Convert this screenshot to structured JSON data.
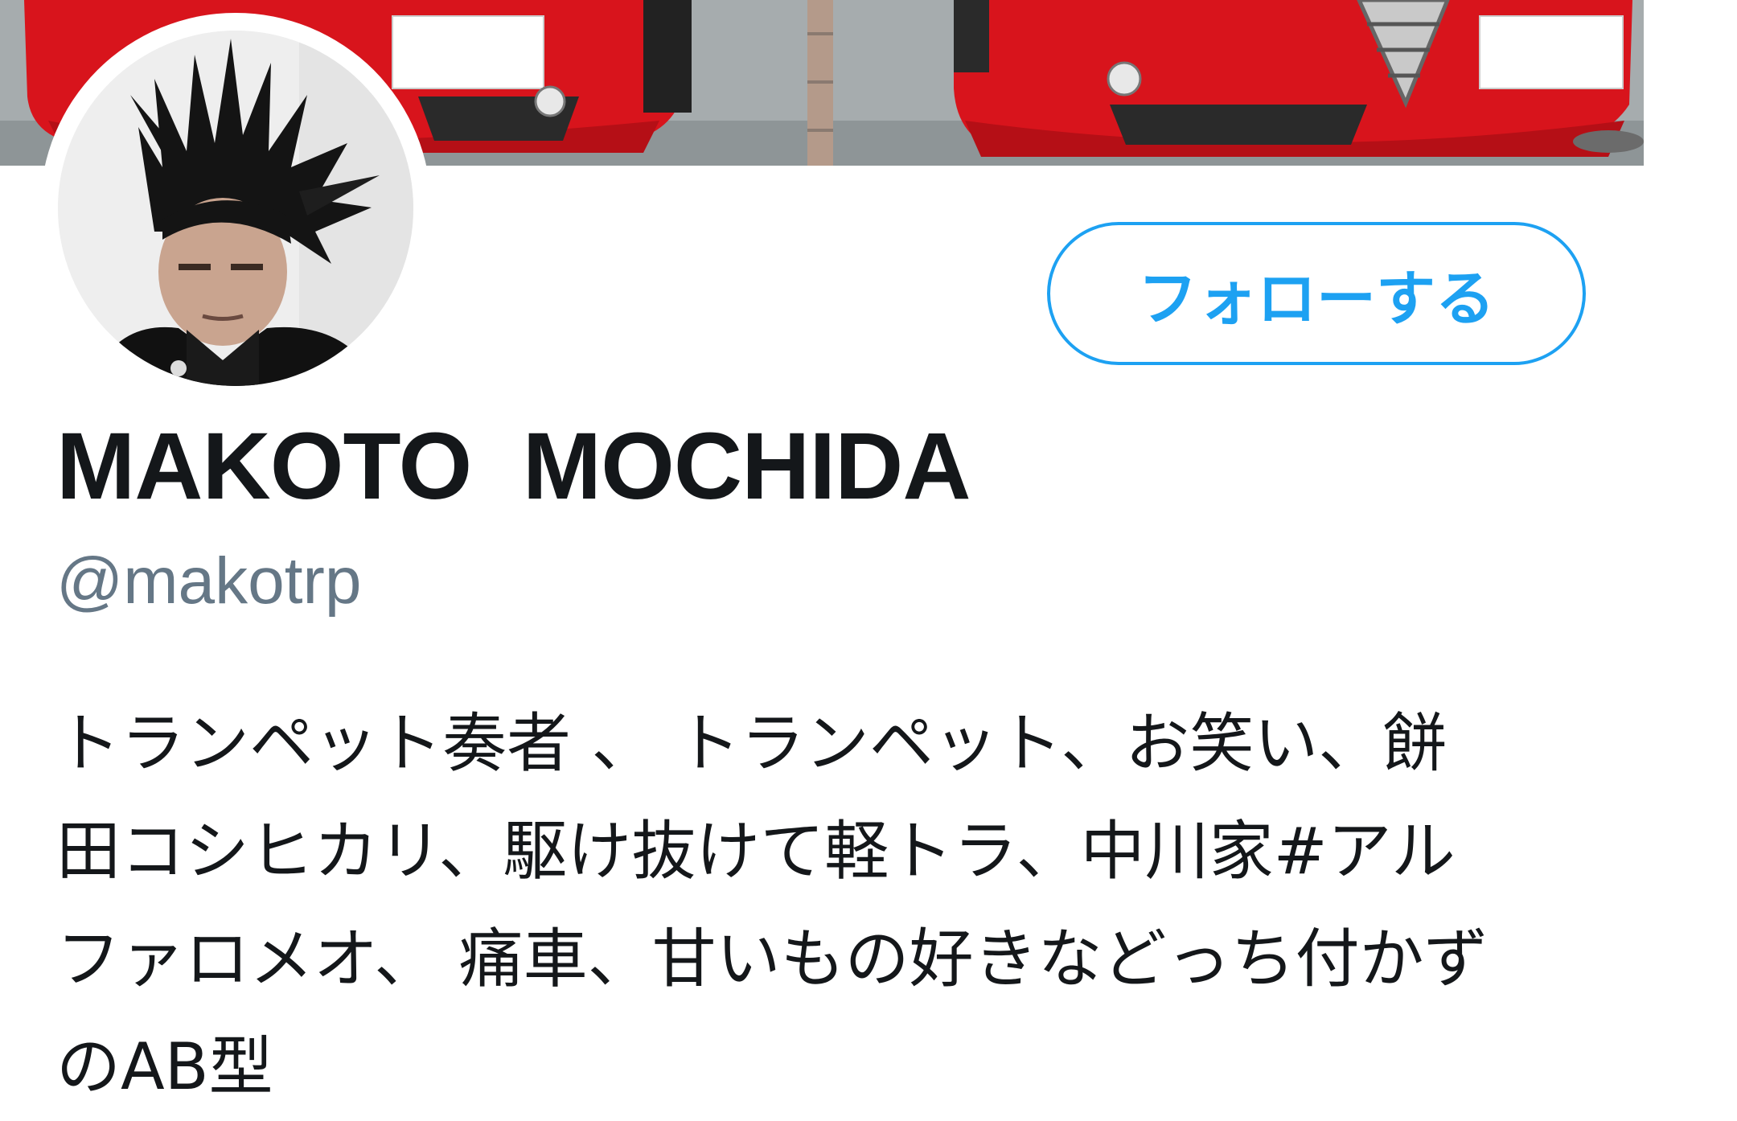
{
  "profile": {
    "display_name": "MAKOTO  MOCHIDA",
    "handle": "@makotrp",
    "follow_label": "フォローする",
    "bio_lines": [
      "トランペット奏者 、 トランペット、お笑い、餅",
      "田コシヒカリ、駆け抜けて軽トラ、中川家#アル",
      "ファロメオ、 痛車、甘いもの好きなどっち付かず",
      "のAB型"
    ]
  },
  "colors": {
    "accent": "#1da1f2",
    "name_text": "#14171a",
    "handle_text": "#657786",
    "banner_car": "#d8141c"
  },
  "icons": {
    "banner": "header-photo-red-cars",
    "avatar": "profile-photo"
  }
}
